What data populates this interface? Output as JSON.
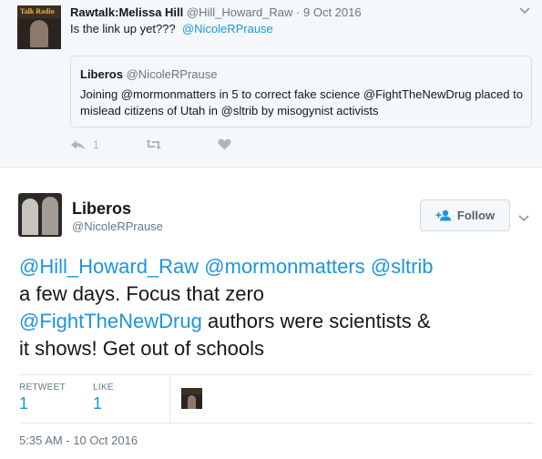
{
  "reply_tweet": {
    "avatar_text": "Talk Radio",
    "name": "Rawtalk:Melissa Hill",
    "handle": "@Hill_Howard_Raw",
    "separator": " · ",
    "date": "9 Oct 2016",
    "text": "Is the link up yet???",
    "mention": "@NicoleRPrause",
    "quote": {
      "name": "Liberos",
      "handle": "@NicoleRPrause",
      "text": "Joining @mormonmatters in 5 to correct fake science @FightTheNewDrug placed to mislead citizens of Utah in @sltrib by misogynist activists"
    },
    "actions": {
      "reply_icon": "reply-icon",
      "reply_count": "1",
      "retweet_icon": "retweet-icon",
      "like_icon": "heart-icon"
    }
  },
  "main_tweet": {
    "name": "Liberos",
    "handle": "@NicoleRPrause",
    "follow_label": "Follow",
    "follow_icon": "add-user-icon",
    "text_lines": [
      [
        "@Hill_Howard_Raw @mormonmatters @sltrib",
        ""
      ],
      [
        "",
        "a few days. Focus that zero"
      ],
      [
        "@FightTheNewDrug",
        " authors were scientists &"
      ],
      [
        "",
        "it shows! Get out of schools"
      ]
    ],
    "stats": {
      "retweet_label": "RETWEET",
      "retweet_count": "1",
      "like_label": "LIKE",
      "like_count": "1"
    },
    "timestamp": "5:35 AM - 10 Oct 2016"
  },
  "colors": {
    "link": "#1b95e0",
    "muted": "#657786",
    "reply_bg": "#f5f8fa",
    "border": "#e1e8ed"
  }
}
